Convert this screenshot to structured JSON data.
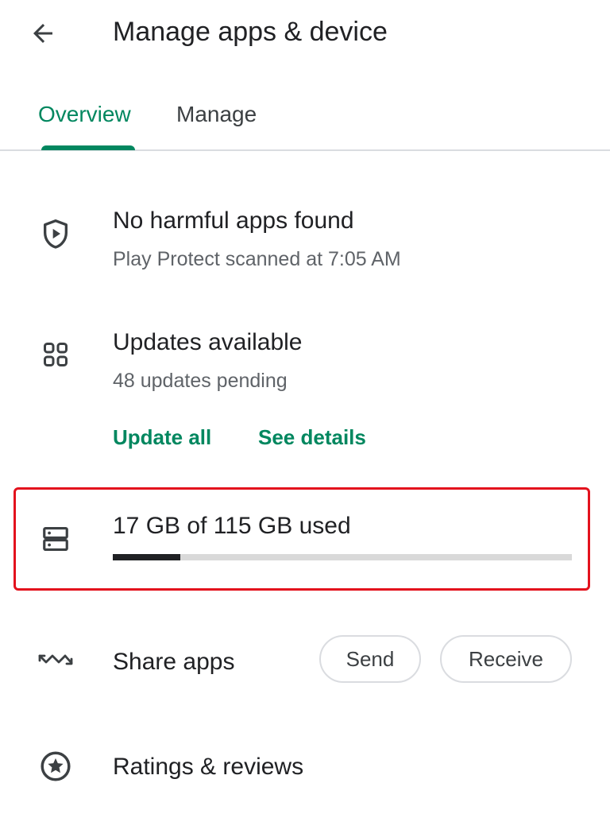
{
  "header": {
    "title": "Manage apps & device",
    "back_icon": "arrow-back-icon"
  },
  "tabs": [
    {
      "label": "Overview",
      "selected": true
    },
    {
      "label": "Manage",
      "selected": false
    }
  ],
  "colors": {
    "accent": "#01875f",
    "highlight_border": "#e3121d",
    "progress_fill": "#202124",
    "progress_track": "#d9d9d9"
  },
  "protect": {
    "icon": "shield-play-icon",
    "title": "No harmful apps found",
    "subtitle": "Play Protect scanned at 7:05 AM"
  },
  "updates": {
    "icon": "apps-grid-icon",
    "title": "Updates available",
    "subtitle": "48 updates pending",
    "update_all_label": "Update all",
    "see_details_label": "See details"
  },
  "storage": {
    "icon": "storage-icon",
    "label": "17 GB of 115 GB used",
    "used_gb": 17,
    "total_gb": 115,
    "used_fraction": 0.1478
  },
  "share": {
    "icon": "share-apps-icon",
    "label": "Share apps",
    "send_label": "Send",
    "receive_label": "Receive"
  },
  "ratings": {
    "icon": "star-circle-icon",
    "label": "Ratings & reviews"
  }
}
